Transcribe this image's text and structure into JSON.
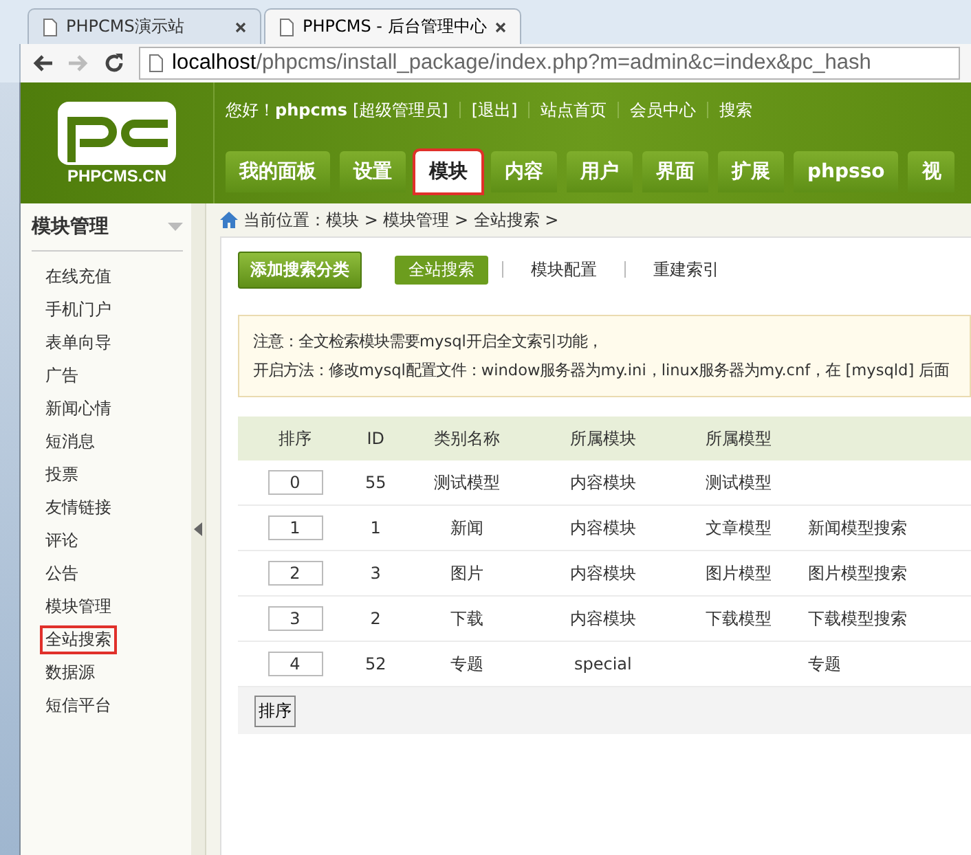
{
  "browser": {
    "tabs": [
      {
        "title": "PHPCMS演示站",
        "selected": false
      },
      {
        "title": "PHPCMS - 后台管理中心",
        "selected": true
      }
    ],
    "address": {
      "host": "localhost",
      "path": "/phpcms/install_package/index.php?m=admin&c=index&pc_hash"
    }
  },
  "header": {
    "logo": "PHPCMS.CN",
    "top_links": [
      {
        "kind": "greeting",
        "text": "您好！"
      },
      {
        "kind": "user",
        "text": "phpcms"
      },
      {
        "kind": "plain",
        "text": "[超级管理员]"
      },
      {
        "kind": "plain",
        "text": "[退出]"
      },
      {
        "kind": "plain",
        "text": "站点首页"
      },
      {
        "kind": "plain",
        "text": "会员中心"
      },
      {
        "kind": "plain",
        "text": "搜索"
      }
    ],
    "nav_tabs": [
      {
        "label": "我的面板",
        "selected": false
      },
      {
        "label": "设置",
        "selected": false
      },
      {
        "label": "模块",
        "selected": true
      },
      {
        "label": "内容",
        "selected": false
      },
      {
        "label": "用户",
        "selected": false
      },
      {
        "label": "界面",
        "selected": false
      },
      {
        "label": "扩展",
        "selected": false
      },
      {
        "label": "phpsso",
        "selected": false
      },
      {
        "label": "视",
        "selected": false
      }
    ]
  },
  "sidebar": {
    "title": "模块管理",
    "items": [
      {
        "label": "在线充值",
        "selected": false
      },
      {
        "label": "手机门户",
        "selected": false
      },
      {
        "label": "表单向导",
        "selected": false
      },
      {
        "label": "广告",
        "selected": false
      },
      {
        "label": "新闻心情",
        "selected": false
      },
      {
        "label": "短消息",
        "selected": false
      },
      {
        "label": "投票",
        "selected": false
      },
      {
        "label": "友情链接",
        "selected": false
      },
      {
        "label": "评论",
        "selected": false
      },
      {
        "label": "公告",
        "selected": false
      },
      {
        "label": "模块管理",
        "selected": false
      },
      {
        "label": "全站搜索",
        "selected": true
      },
      {
        "label": "数据源",
        "selected": false
      },
      {
        "label": "短信平台",
        "selected": false
      }
    ]
  },
  "breadcrumb": "当前位置：模块 > 模块管理 > 全站搜索 >",
  "subnav": [
    {
      "kind": "button",
      "label": "添加搜索分类"
    },
    {
      "kind": "link",
      "label": "全站搜索",
      "selected": true
    },
    {
      "kind": "link",
      "label": "模块配置",
      "selected": false
    },
    {
      "kind": "link",
      "label": "重建索引",
      "selected": false
    }
  ],
  "notice": [
    "注意：全文检索模块需要mysql开启全文索引功能，",
    "开启方法：修改mysql配置文件：window服务器为my.ini，linux服务器为my.cnf，在 [mysqld] 后面"
  ],
  "table": {
    "columns": [
      "排序",
      "ID",
      "类别名称",
      "所属模块",
      "所属模型"
    ],
    "rows": [
      {
        "order": "0",
        "id": "55",
        "name": "测试模型",
        "module": "内容模块",
        "model": "测试模型"
      },
      {
        "order": "1",
        "id": "1",
        "name": "新闻",
        "module": "内容模块",
        "model": "文章模型",
        "column_6": "新闻模型搜索"
      },
      {
        "order": "2",
        "id": "3",
        "name": "图片",
        "module": "内容模块",
        "model": "图片模型",
        "column_6": "图片模型搜索"
      },
      {
        "order": "3",
        "id": "2",
        "name": "下载",
        "module": "内容模块",
        "model": "下载模型",
        "column_6": "下载模型搜索"
      },
      {
        "order": "4",
        "id": "52",
        "name": "专题",
        "module": "special",
        "column_6": "专题"
      }
    ]
  },
  "sort_button": "排序"
}
